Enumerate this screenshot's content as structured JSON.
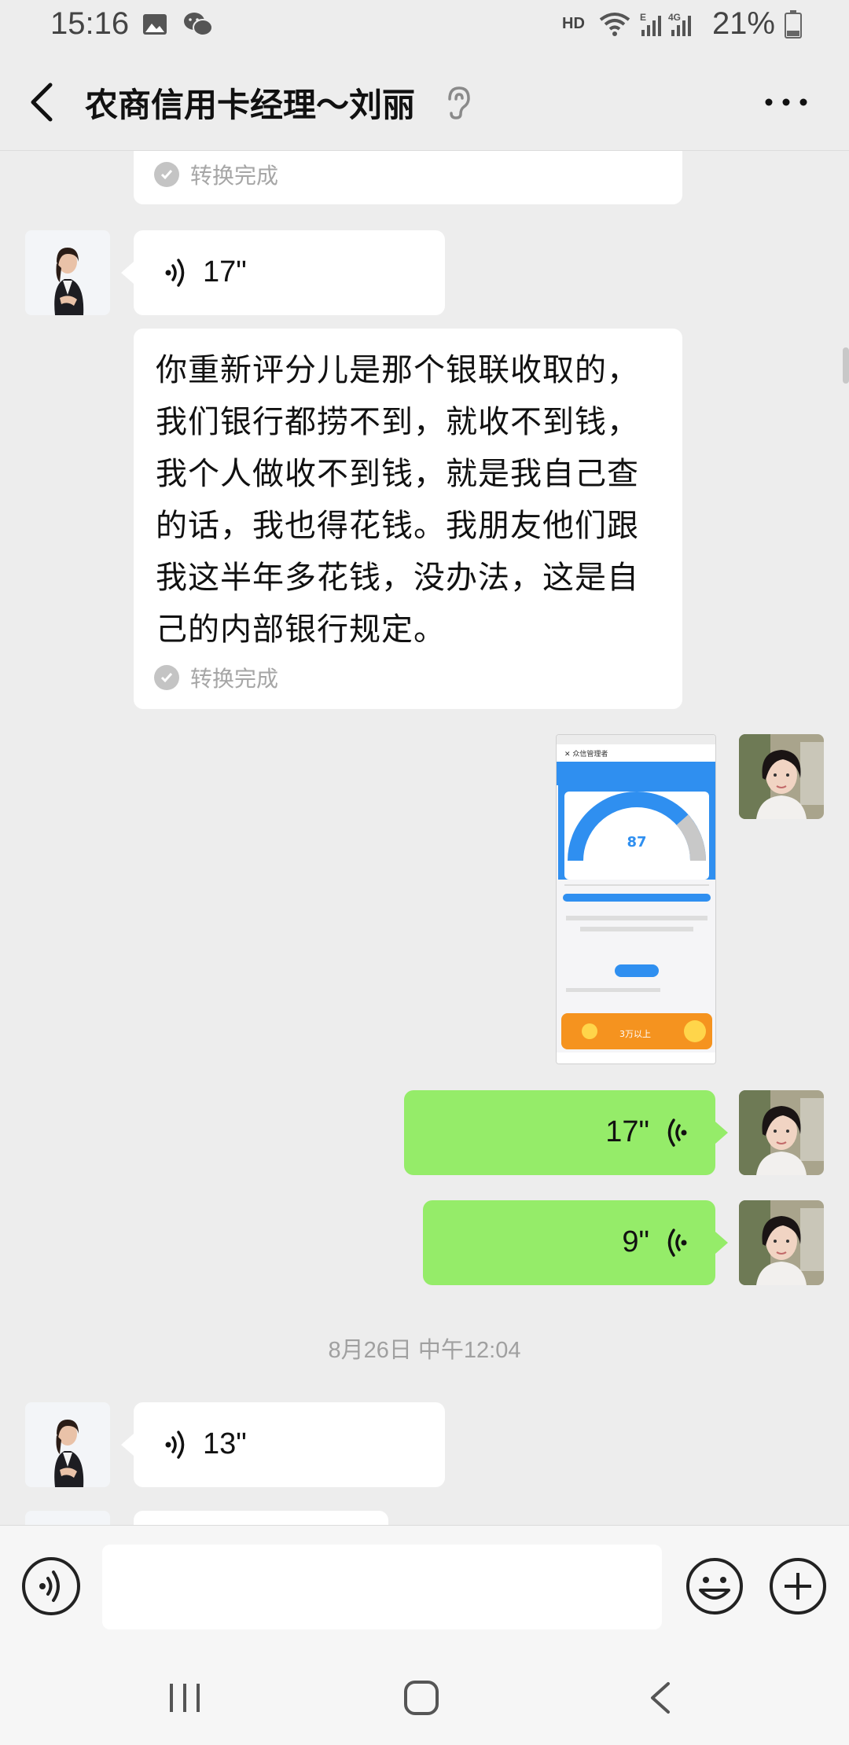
{
  "status_bar": {
    "time": "15:16",
    "hd": "HD",
    "battery": "21%"
  },
  "header": {
    "title": "农商信用卡经理〜刘丽"
  },
  "messages": {
    "convert_done_1": "转换完成",
    "voice_1_duration": "17\"",
    "transcript_1": [
      "你重新评分儿是那个银联收取的，",
      "我们银行都捞不到，就收不到钱，",
      "我个人做收不到钱，就是我自己查",
      "的话，我也得花钱。我朋友他们跟",
      "我这半年多花钱，没办法，这是自",
      "己的内部银行规定。"
    ],
    "convert_done_2": "转换完成",
    "voice_2_duration": "17\"",
    "voice_3_duration": "9\"",
    "timestamp": "8月26日 中午12:04",
    "voice_4_duration": "13\""
  },
  "thumbnail": {
    "app_title": "众信管理者",
    "score": "87",
    "banner": "3万以上"
  },
  "colors": {
    "sent_bubble": "#95ec69",
    "received_bubble": "#ffffff",
    "background": "#ededed"
  }
}
